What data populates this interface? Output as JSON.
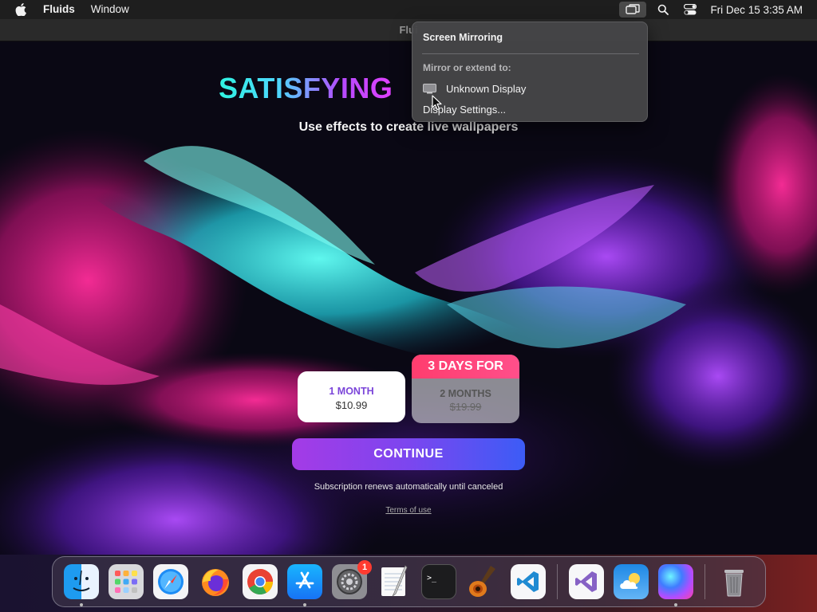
{
  "menubar": {
    "app_name": "Fluids",
    "items": [
      "Window"
    ],
    "clock": "Fri Dec 15  3:35 AM",
    "status_icons": [
      "screen-mirroring-icon",
      "search-icon",
      "control-center-icon"
    ]
  },
  "window": {
    "title": "Flui"
  },
  "paywall": {
    "headline": "SATISFYING",
    "subtitle": "Use effects to create live wallpapers",
    "plan_month": {
      "name": "1 MONTH",
      "price": "$10.99"
    },
    "plan_trial": {
      "badge": "3 DAYS FOR",
      "name": "2 MONTHS",
      "price": "$19.99"
    },
    "continue_label": "CONTINUE",
    "renew_note": "Subscription renews automatically until canceled",
    "terms_label": "Terms of use"
  },
  "popover": {
    "title": "Screen Mirroring",
    "section_label": "Mirror or extend to:",
    "display_name": "Unknown Display",
    "settings_label": "Display Settings..."
  },
  "dock": {
    "apps": [
      {
        "name": "Finder",
        "icon": "finder-icon",
        "running": true
      },
      {
        "name": "Launchpad",
        "icon": "launchpad-icon",
        "running": false
      },
      {
        "name": "Safari",
        "icon": "safari-icon",
        "running": false
      },
      {
        "name": "Firefox",
        "icon": "firefox-icon",
        "running": false
      },
      {
        "name": "Google Chrome",
        "icon": "chrome-icon",
        "running": false
      },
      {
        "name": "App Store",
        "icon": "app-store-icon",
        "running": true
      },
      {
        "name": "System Settings",
        "icon": "settings-icon",
        "running": false,
        "badge": "1"
      },
      {
        "name": "TextEdit",
        "icon": "textedit-icon",
        "running": false
      },
      {
        "name": "Terminal",
        "icon": "terminal-icon",
        "running": false
      },
      {
        "name": "GarageBand",
        "icon": "garageband-icon",
        "running": false
      },
      {
        "name": "Visual Studio Code",
        "icon": "vscode-icon",
        "running": false
      },
      {
        "name": "Visual Studio",
        "icon": "visual-studio-icon",
        "running": false
      },
      {
        "name": "Weather",
        "icon": "weather-icon",
        "running": false
      },
      {
        "name": "Fluids",
        "icon": "fluids-icon",
        "running": true
      },
      {
        "name": "Trash",
        "icon": "trash-icon",
        "running": false
      }
    ]
  },
  "colors": {
    "continue_gradient_start": "#a43be6",
    "continue_gradient_end": "#3c5cf6",
    "trial_badge": "#ff3d6e",
    "month_plan_text": "#7b45d9",
    "notification_badge": "#ff3b30"
  }
}
